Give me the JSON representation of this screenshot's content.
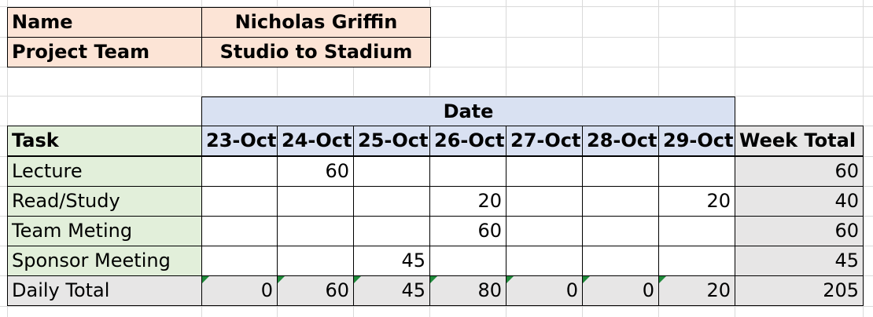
{
  "info": {
    "name_label": "Name",
    "name_value": "Nicholas Griffin",
    "team_label": "Project Team",
    "team_value": "Studio to Stadium"
  },
  "table": {
    "date_header": "Date",
    "task_header": "Task",
    "week_total_header": "Week Total",
    "dates": [
      "23-Oct",
      "24-Oct",
      "25-Oct",
      "26-Oct",
      "27-Oct",
      "28-Oct",
      "29-Oct"
    ],
    "rows": [
      {
        "task": "Lecture",
        "values": [
          "",
          "60",
          "",
          "",
          "",
          "",
          ""
        ],
        "total": "60"
      },
      {
        "task": "Read/Study",
        "values": [
          "",
          "",
          "",
          "20",
          "",
          "",
          "20"
        ],
        "total": "40"
      },
      {
        "task": "Team Meting",
        "values": [
          "",
          "",
          "",
          "60",
          "",
          "",
          ""
        ],
        "total": "60"
      },
      {
        "task": "Sponsor Meeting",
        "values": [
          "",
          "",
          "45",
          "",
          "",
          "",
          ""
        ],
        "total": "45"
      }
    ],
    "daily_total_label": "Daily Total",
    "daily_totals": [
      "0",
      "60",
      "45",
      "80",
      "0",
      "0",
      "20"
    ],
    "grand_total": "205"
  },
  "colors": {
    "info_fill": "#fce4d6",
    "date_fill": "#d9e1f2",
    "task_fill": "#e2efda",
    "total_fill": "#e7e6e6",
    "error_flag": "#1f8a3a"
  }
}
